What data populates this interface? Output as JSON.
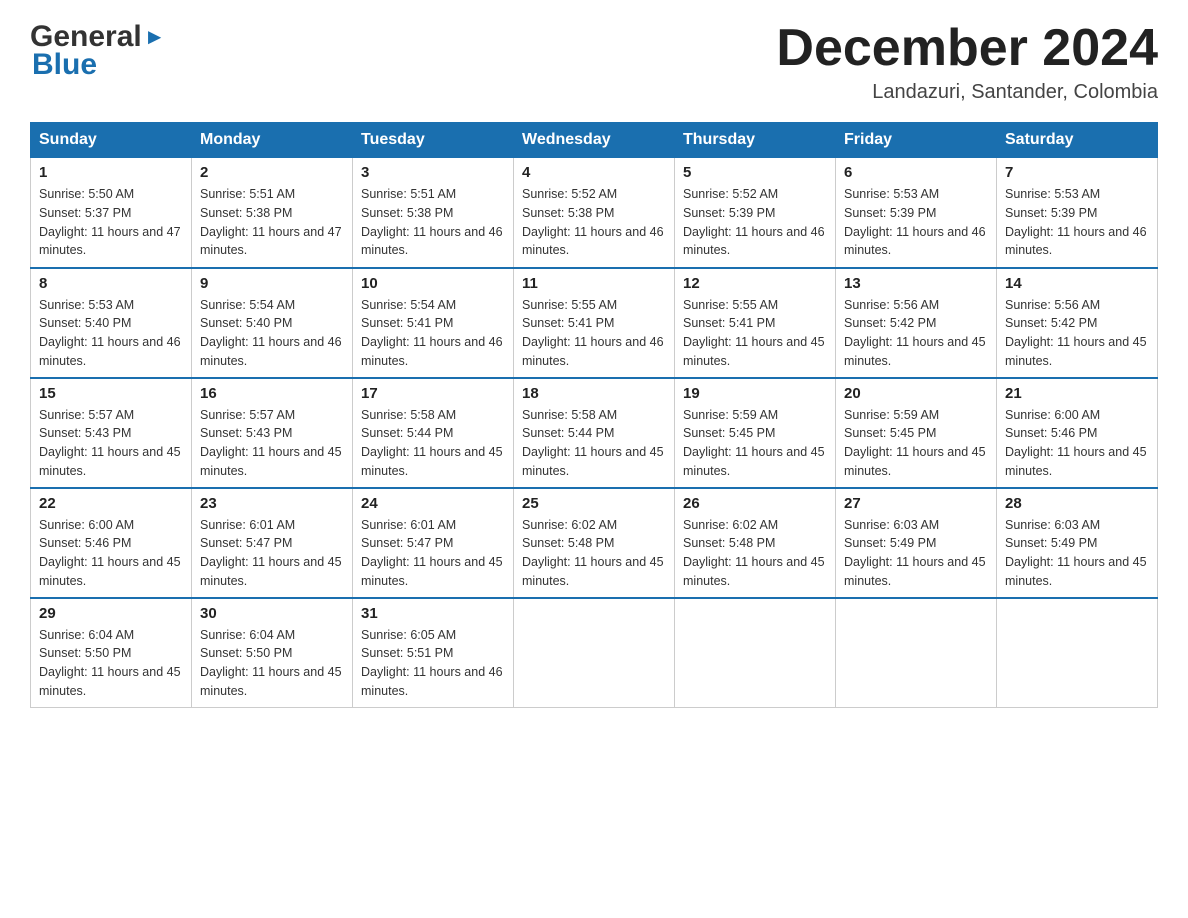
{
  "header": {
    "logo_general": "General",
    "logo_blue": "Blue",
    "month_title": "December 2024",
    "location": "Landazuri, Santander, Colombia"
  },
  "days_of_week": [
    "Sunday",
    "Monday",
    "Tuesday",
    "Wednesday",
    "Thursday",
    "Friday",
    "Saturday"
  ],
  "weeks": [
    [
      {
        "day": "1",
        "sunrise": "5:50 AM",
        "sunset": "5:37 PM",
        "daylight": "11 hours and 47 minutes."
      },
      {
        "day": "2",
        "sunrise": "5:51 AM",
        "sunset": "5:38 PM",
        "daylight": "11 hours and 47 minutes."
      },
      {
        "day": "3",
        "sunrise": "5:51 AM",
        "sunset": "5:38 PM",
        "daylight": "11 hours and 46 minutes."
      },
      {
        "day": "4",
        "sunrise": "5:52 AM",
        "sunset": "5:38 PM",
        "daylight": "11 hours and 46 minutes."
      },
      {
        "day": "5",
        "sunrise": "5:52 AM",
        "sunset": "5:39 PM",
        "daylight": "11 hours and 46 minutes."
      },
      {
        "day": "6",
        "sunrise": "5:53 AM",
        "sunset": "5:39 PM",
        "daylight": "11 hours and 46 minutes."
      },
      {
        "day": "7",
        "sunrise": "5:53 AM",
        "sunset": "5:39 PM",
        "daylight": "11 hours and 46 minutes."
      }
    ],
    [
      {
        "day": "8",
        "sunrise": "5:53 AM",
        "sunset": "5:40 PM",
        "daylight": "11 hours and 46 minutes."
      },
      {
        "day": "9",
        "sunrise": "5:54 AM",
        "sunset": "5:40 PM",
        "daylight": "11 hours and 46 minutes."
      },
      {
        "day": "10",
        "sunrise": "5:54 AM",
        "sunset": "5:41 PM",
        "daylight": "11 hours and 46 minutes."
      },
      {
        "day": "11",
        "sunrise": "5:55 AM",
        "sunset": "5:41 PM",
        "daylight": "11 hours and 46 minutes."
      },
      {
        "day": "12",
        "sunrise": "5:55 AM",
        "sunset": "5:41 PM",
        "daylight": "11 hours and 45 minutes."
      },
      {
        "day": "13",
        "sunrise": "5:56 AM",
        "sunset": "5:42 PM",
        "daylight": "11 hours and 45 minutes."
      },
      {
        "day": "14",
        "sunrise": "5:56 AM",
        "sunset": "5:42 PM",
        "daylight": "11 hours and 45 minutes."
      }
    ],
    [
      {
        "day": "15",
        "sunrise": "5:57 AM",
        "sunset": "5:43 PM",
        "daylight": "11 hours and 45 minutes."
      },
      {
        "day": "16",
        "sunrise": "5:57 AM",
        "sunset": "5:43 PM",
        "daylight": "11 hours and 45 minutes."
      },
      {
        "day": "17",
        "sunrise": "5:58 AM",
        "sunset": "5:44 PM",
        "daylight": "11 hours and 45 minutes."
      },
      {
        "day": "18",
        "sunrise": "5:58 AM",
        "sunset": "5:44 PM",
        "daylight": "11 hours and 45 minutes."
      },
      {
        "day": "19",
        "sunrise": "5:59 AM",
        "sunset": "5:45 PM",
        "daylight": "11 hours and 45 minutes."
      },
      {
        "day": "20",
        "sunrise": "5:59 AM",
        "sunset": "5:45 PM",
        "daylight": "11 hours and 45 minutes."
      },
      {
        "day": "21",
        "sunrise": "6:00 AM",
        "sunset": "5:46 PM",
        "daylight": "11 hours and 45 minutes."
      }
    ],
    [
      {
        "day": "22",
        "sunrise": "6:00 AM",
        "sunset": "5:46 PM",
        "daylight": "11 hours and 45 minutes."
      },
      {
        "day": "23",
        "sunrise": "6:01 AM",
        "sunset": "5:47 PM",
        "daylight": "11 hours and 45 minutes."
      },
      {
        "day": "24",
        "sunrise": "6:01 AM",
        "sunset": "5:47 PM",
        "daylight": "11 hours and 45 minutes."
      },
      {
        "day": "25",
        "sunrise": "6:02 AM",
        "sunset": "5:48 PM",
        "daylight": "11 hours and 45 minutes."
      },
      {
        "day": "26",
        "sunrise": "6:02 AM",
        "sunset": "5:48 PM",
        "daylight": "11 hours and 45 minutes."
      },
      {
        "day": "27",
        "sunrise": "6:03 AM",
        "sunset": "5:49 PM",
        "daylight": "11 hours and 45 minutes."
      },
      {
        "day": "28",
        "sunrise": "6:03 AM",
        "sunset": "5:49 PM",
        "daylight": "11 hours and 45 minutes."
      }
    ],
    [
      {
        "day": "29",
        "sunrise": "6:04 AM",
        "sunset": "5:50 PM",
        "daylight": "11 hours and 45 minutes."
      },
      {
        "day": "30",
        "sunrise": "6:04 AM",
        "sunset": "5:50 PM",
        "daylight": "11 hours and 45 minutes."
      },
      {
        "day": "31",
        "sunrise": "6:05 AM",
        "sunset": "5:51 PM",
        "daylight": "11 hours and 46 minutes."
      },
      null,
      null,
      null,
      null
    ]
  ]
}
